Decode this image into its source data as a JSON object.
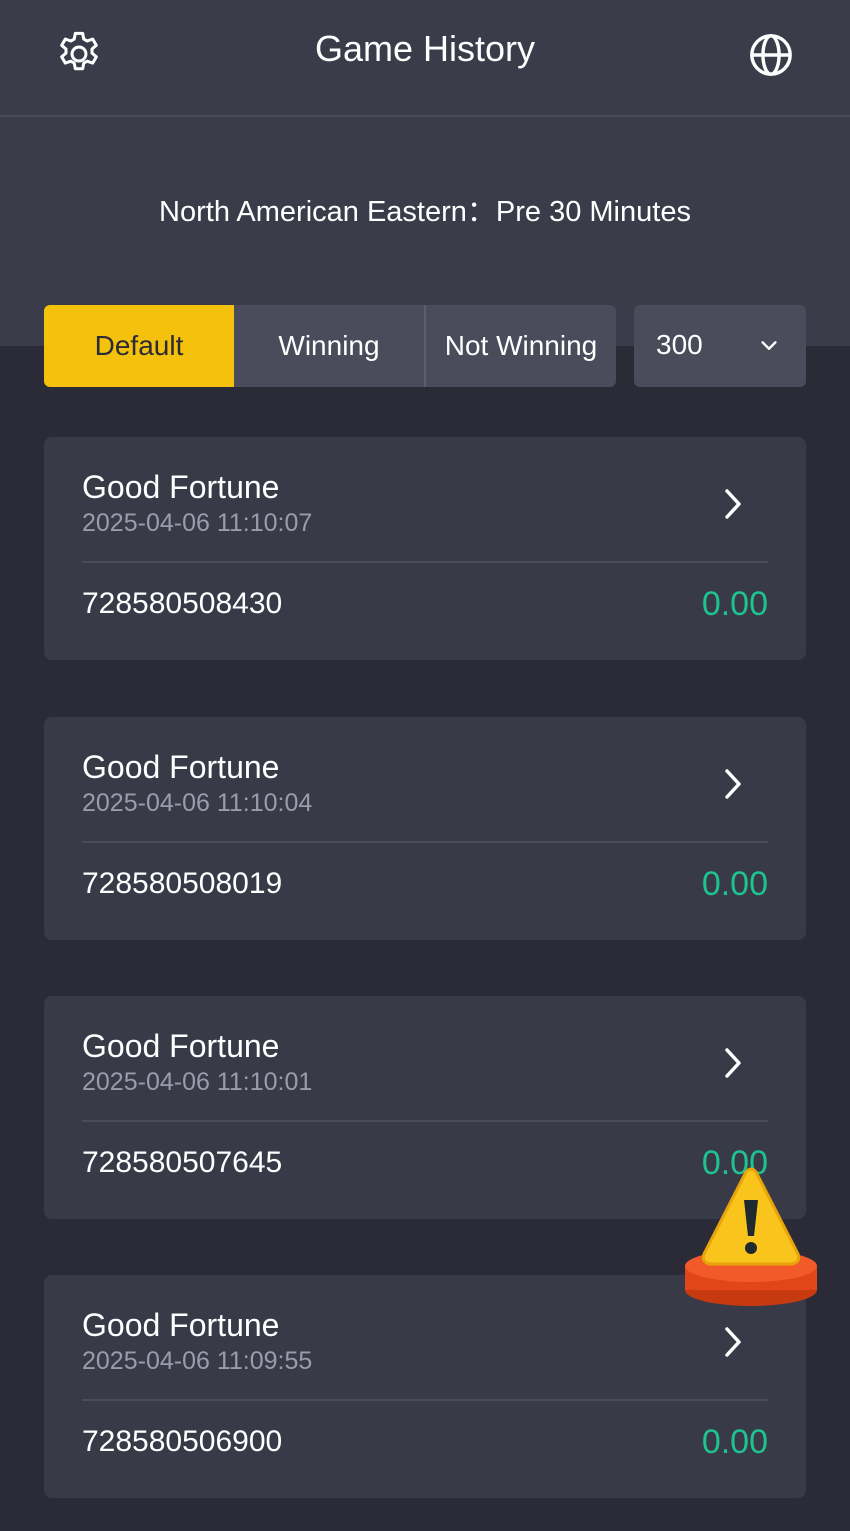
{
  "header": {
    "title": "Game History",
    "settings_icon": "gear-icon",
    "language_icon": "globe-icon"
  },
  "timezone": {
    "text": "North American Eastern：Pre 30 Minutes"
  },
  "filters": {
    "tabs": [
      {
        "label": "Default",
        "active": true
      },
      {
        "label": "Winning",
        "active": false
      },
      {
        "label": "Not Winning",
        "active": false
      }
    ],
    "count_select": {
      "value": "300",
      "icon": "chevron-down-icon"
    }
  },
  "records": [
    {
      "game": "Good Fortune",
      "time": "2025-04-06 11:10:07",
      "id": "728580508430",
      "amount": "0.00"
    },
    {
      "game": "Good Fortune",
      "time": "2025-04-06 11:10:04",
      "id": "728580508019",
      "amount": "0.00"
    },
    {
      "game": "Good Fortune",
      "time": "2025-04-06 11:10:01",
      "id": "728580507645",
      "amount": "0.00"
    },
    {
      "game": "Good Fortune",
      "time": "2025-04-06 11:09:55",
      "id": "728580506900",
      "amount": "0.00"
    }
  ],
  "colors": {
    "background": "#2a2b37",
    "header": "#3a3c4a",
    "accent": "#f4c20d",
    "amount": "#1fc38f",
    "card": "#383a48"
  },
  "floating_icon": "warning-icon"
}
